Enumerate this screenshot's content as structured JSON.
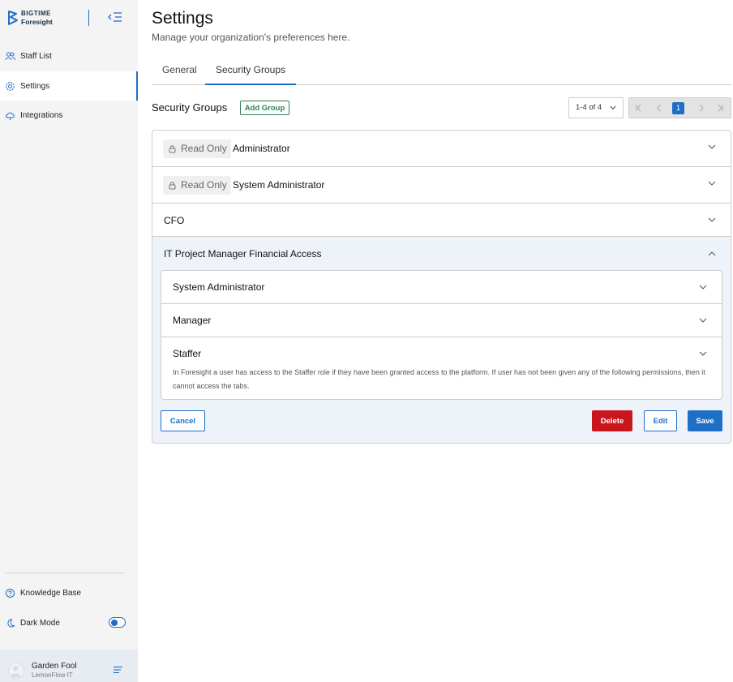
{
  "sidebar": {
    "logo": {
      "line1": "BIGTIME",
      "line2": "Foresight"
    },
    "nav": [
      {
        "label": "Staff List",
        "icon": "users-icon"
      },
      {
        "label": "Settings",
        "icon": "gear-icon",
        "active": true
      },
      {
        "label": "Integrations",
        "icon": "cloud-icon"
      }
    ],
    "bottom": [
      {
        "label": "Knowledge Base",
        "icon": "question-circle-icon"
      },
      {
        "label": "Dark Mode",
        "icon": "moon-icon",
        "toggle_on": true
      }
    ],
    "user": {
      "name": "Garden Fool",
      "org": "LemonFlow IT"
    }
  },
  "header": {
    "title": "Settings",
    "subtitle": "Manage your organization's preferences here."
  },
  "tabs": [
    {
      "label": "General",
      "active": false
    },
    {
      "label": "Security Groups",
      "active": true
    }
  ],
  "security_groups": {
    "title": "Security Groups",
    "add_button": "Add Group",
    "range_select": "1-4 of 4",
    "current_page": "1",
    "groups": [
      {
        "name": "Administrator",
        "read_only": true,
        "badge": "Read Only"
      },
      {
        "name": "System Administrator",
        "read_only": true,
        "badge": "Read Only"
      },
      {
        "name": "CFO",
        "read_only": false
      },
      {
        "name": "IT Project Manager Financial Access",
        "read_only": false,
        "expanded": true
      }
    ],
    "roles": [
      {
        "name": "System Administrator"
      },
      {
        "name": "Manager"
      },
      {
        "name": "Staffer",
        "description": "In Foresight a user has access to the Staffer role if they have been granted access to the platform. If user has not been given any of the following permissions, then it cannot access the tabs."
      }
    ],
    "actions": {
      "cancel": "Cancel",
      "delete": "Delete",
      "edit": "Edit",
      "save": "Save"
    }
  },
  "colors": {
    "accent": "#1f6fc7",
    "danger": "#c8161d",
    "success": "#2e7f53"
  }
}
